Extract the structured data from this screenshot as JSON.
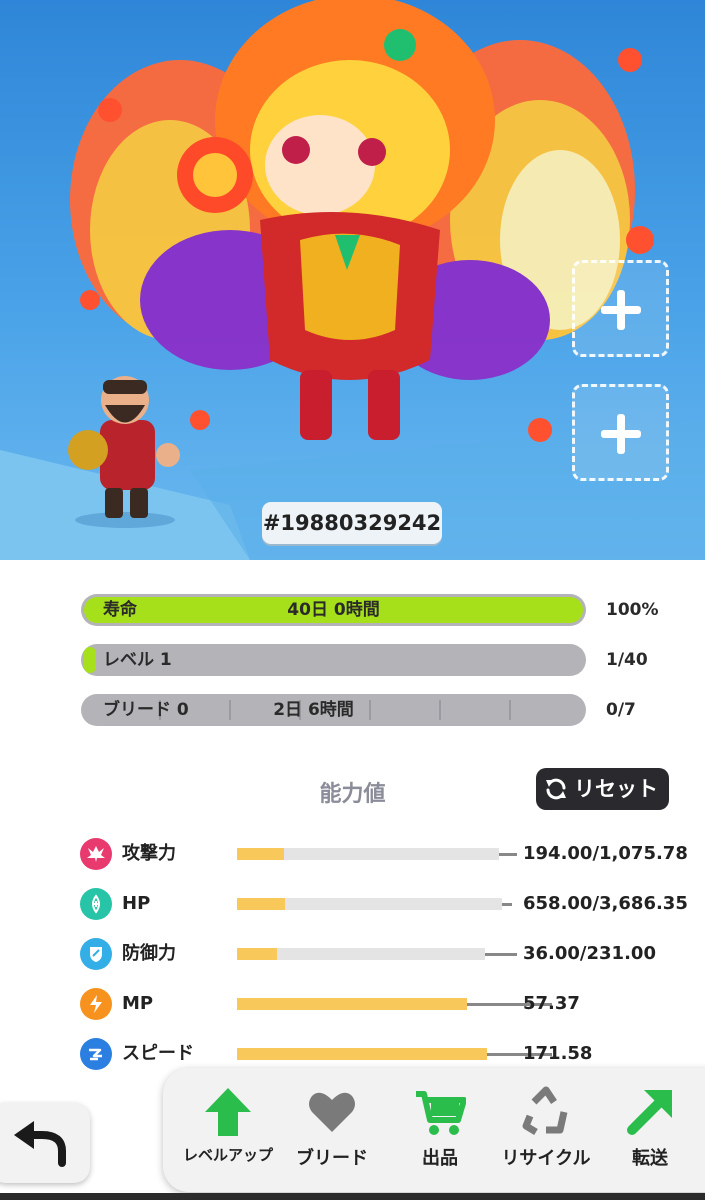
{
  "hero": {
    "id_label": "#19880329242"
  },
  "bars": {
    "lifespan": {
      "label": "寿命",
      "center": "40日 0時間",
      "value": "100%",
      "fill": 1.0
    },
    "level": {
      "label": "レベル 1",
      "value": "1/40",
      "fill": 0.025
    },
    "breed": {
      "label": "ブリード 0",
      "center": "2日 6時間",
      "value": "0/7"
    }
  },
  "stats": {
    "title": "能力値",
    "reset_label": "リセット",
    "items": [
      {
        "name": "攻撃力",
        "value": "194.00/1,075.78",
        "fill": 0.18,
        "color": "#e83a6f",
        "icon": "attack-icon"
      },
      {
        "name": "HP",
        "value": "658.00/3,686.35",
        "fill": 0.18,
        "color": "#27c4a8",
        "icon": "hp-icon"
      },
      {
        "name": "防御力",
        "value": "36.00/231.00",
        "fill": 0.16,
        "color": "#33aee6",
        "icon": "defense-icon"
      },
      {
        "name": "MP",
        "value": "57.37",
        "fill": 1.0,
        "color": "#f7921e",
        "icon": "mp-icon"
      },
      {
        "name": "スピード",
        "value": "171.58",
        "fill": 1.0,
        "color": "#2a7fe0",
        "icon": "speed-icon"
      }
    ]
  },
  "toolbar": {
    "level_up": "レベルアップ",
    "breed": "ブリード",
    "sell": "出品",
    "recycle": "リサイクル",
    "transfer": "転送"
  },
  "colors": {
    "lifespan_fill": "#a6e01a",
    "stat_fill": "#f9c85a",
    "level_up_green": "#2bbd4c"
  }
}
